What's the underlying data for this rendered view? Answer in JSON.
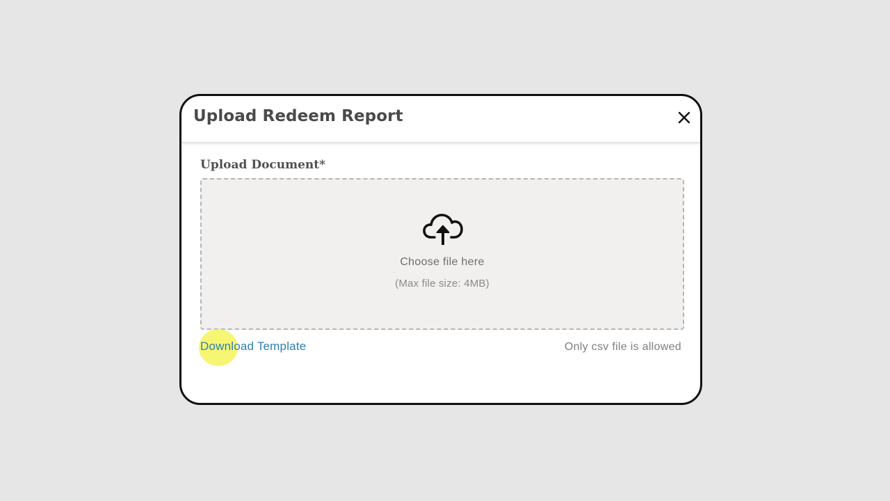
{
  "modal": {
    "title": "Upload Redeem Report",
    "close_icon": "close-icon"
  },
  "upload": {
    "label": "Upload Document*",
    "icon": "cloud-upload-icon",
    "choose_text": "Choose file here",
    "max_size_text": "(Max file size: 4MB)",
    "allowed_text": "Only csv file is allowed"
  },
  "links": {
    "download_template": "Download Template"
  },
  "colors": {
    "link": "#2f7fb0",
    "dropzone_bg": "#f1f0ee",
    "cursor_highlight": "#f4f55c"
  }
}
